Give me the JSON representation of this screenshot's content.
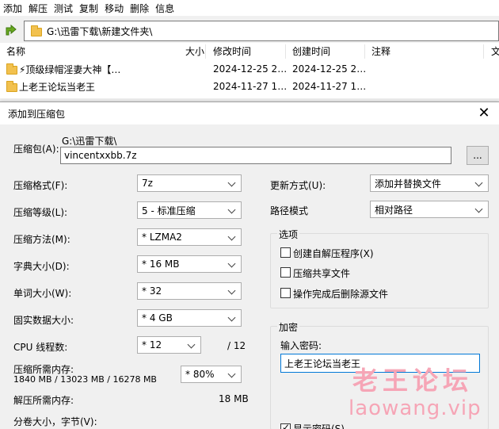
{
  "menu": [
    "添加",
    "解压",
    "测试",
    "复制",
    "移动",
    "删除",
    "信息"
  ],
  "path": "G:\\迅雷下载\\新建文件夹\\",
  "columns": {
    "name": "名称",
    "size": "大小",
    "modified": "修改时间",
    "created": "创建时间",
    "comment": "注释",
    "extra": "文"
  },
  "files": [
    {
      "name": "⚡顶级绿帽淫妻大神【…",
      "modified": "2024-12-25 2…",
      "created": "2024-12-25 2…"
    },
    {
      "name": "上老王论坛当老王",
      "modified": "2024-11-27 1…",
      "created": "2024-11-27 1…"
    }
  ],
  "dialog": {
    "title": "添加到压缩包",
    "archive_label": "压缩包(A):",
    "archive_dir": "G:\\迅雷下载\\",
    "archive_name": "vincentxxbb.7z",
    "browse_label": "...",
    "format_label": "压缩格式(F):",
    "format_value": "7z",
    "level_label": "压缩等级(L):",
    "level_value": "5 - 标准压缩",
    "method_label": "压缩方法(M):",
    "method_value": "* LZMA2",
    "dict_label": "字典大小(D):",
    "dict_value": "* 16 MB",
    "word_label": "单词大小(W):",
    "word_value": "* 32",
    "solid_label": "固实数据大小:",
    "solid_value": "* 4 GB",
    "threads_label": "CPU 线程数:",
    "threads_value": "* 12",
    "threads_total": "/ 12",
    "mem_label": "压缩所需内存:",
    "mem_value": "1840 MB / 13023 MB / 16278 MB",
    "mem_pct": "* 80%",
    "decomp_label": "解压所需内存:",
    "decomp_value": "18 MB",
    "volume_label": "分卷大小，字节(V):",
    "update_label": "更新方式(U):",
    "update_value": "添加并替换文件",
    "pathmode_label": "路径模式",
    "pathmode_value": "相对路径",
    "options_title": "选项",
    "opt_sfx": "创建自解压程序(X)",
    "opt_shared": "压缩共享文件",
    "opt_delete": "操作完成后删除源文件",
    "encrypt_title": "加密",
    "password_label": "输入密码:",
    "password_value": "上老王论坛当老王",
    "show_password": "显示密码(S)"
  },
  "watermark": {
    "cn": "老王论坛",
    "url": "laowang.vip"
  }
}
